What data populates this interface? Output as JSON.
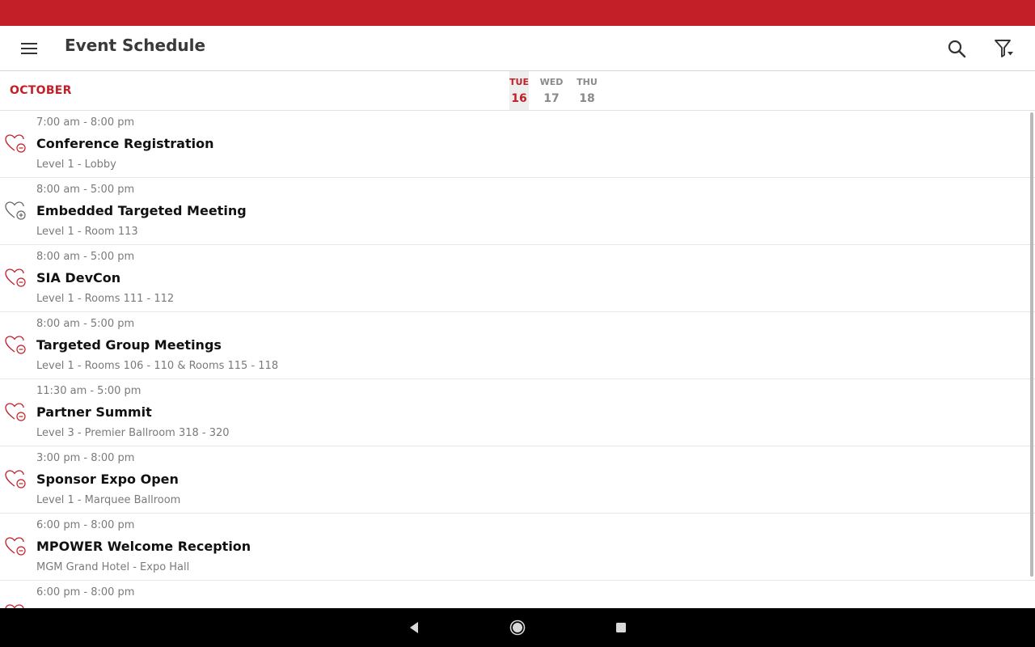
{
  "app_bar": {
    "title": "Event Schedule",
    "menu_icon": "hamburger-menu-icon",
    "search_icon": "search-icon",
    "filter_icon": "filter-icon"
  },
  "colors": {
    "status_bar": "#c21f28",
    "accent": "#c21f28",
    "nav_bar": "#000000"
  },
  "date_header": {
    "month": "OCTOBER",
    "days": [
      {
        "name": "TUE",
        "num": "16",
        "selected": true
      },
      {
        "name": "WED",
        "num": "17",
        "selected": false
      },
      {
        "name": "THU",
        "num": "18",
        "selected": false
      }
    ]
  },
  "events": [
    {
      "time": "7:00 am - 8:00 pm",
      "title": "Conference Registration",
      "location": "Level 1 - Lobby",
      "favorite_state": "remove"
    },
    {
      "time": "8:00 am - 5:00 pm",
      "title": "Embedded Targeted Meeting",
      "location": "Level 1 - Room 113",
      "favorite_state": "add"
    },
    {
      "time": "8:00 am - 5:00 pm",
      "title": "SIA DevCon",
      "location": "Level 1 - Rooms 111 - 112",
      "favorite_state": "remove"
    },
    {
      "time": "8:00 am - 5:00 pm",
      "title": "Targeted Group Meetings",
      "location": "Level 1 - Rooms 106 - 110 & Rooms 115 - 118",
      "favorite_state": "remove"
    },
    {
      "time": "11:30 am - 5:00 pm",
      "title": "Partner Summit",
      "location": "Level 3 - Premier Ballroom 318 - 320",
      "favorite_state": "remove"
    },
    {
      "time": "3:00 pm - 8:00 pm",
      "title": "Sponsor Expo Open",
      "location": "Level 1 - Marquee Ballroom",
      "favorite_state": "remove"
    },
    {
      "time": "6:00 pm - 8:00 pm",
      "title": "MPOWER Welcome Reception",
      "location": "MGM Grand Hotel - Expo Hall",
      "favorite_state": "remove"
    },
    {
      "time": "6:00 pm - 8:00 pm",
      "title": "",
      "location": "",
      "favorite_state": "remove"
    }
  ],
  "nav_bar": {
    "back_icon": "back-triangle-icon",
    "home_icon": "home-circle-icon",
    "recents_icon": "recents-square-icon"
  }
}
